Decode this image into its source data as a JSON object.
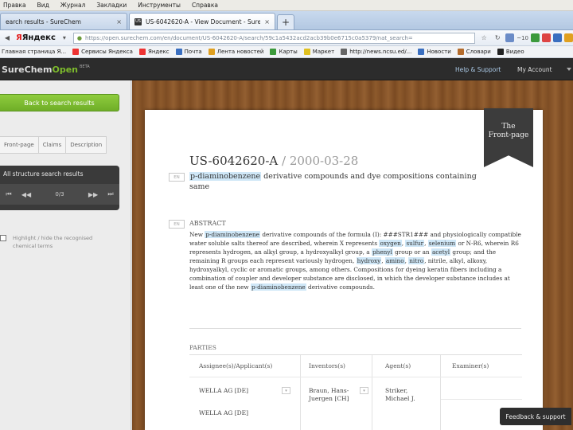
{
  "menu": [
    "Правка",
    "Вид",
    "Журнал",
    "Закладки",
    "Инструменты",
    "Справка"
  ],
  "tabs": [
    {
      "label": "earch results - SureChem",
      "active": false
    },
    {
      "label": "US-6042620-A - View Document - SureCh...",
      "active": true
    }
  ],
  "new_tab": "+",
  "navbar": {
    "brand": "Яндекс",
    "url": "https://open.surechem.com/en/document/US-6042620-A/search/59c1a5432acd2acb39b0e6715c0a5379/nat_search=",
    "right_text": "~10"
  },
  "bookmarks": [
    {
      "label": "Главная страница Я..."
    },
    {
      "label": "Сервисы Яндекса"
    },
    {
      "label": "Яндекс"
    },
    {
      "label": "Почта"
    },
    {
      "label": "Лента новостей"
    },
    {
      "label": "Карты"
    },
    {
      "label": "Маркет"
    },
    {
      "label": "http://news.ncsu.ed/..."
    },
    {
      "label": "Новости"
    },
    {
      "label": "Словари"
    },
    {
      "label": "Видео"
    }
  ],
  "app": {
    "logo_a": "SureChem",
    "logo_b": "Open",
    "beta": "BETA",
    "help": "Help & Support",
    "account": "My Account"
  },
  "sidebar": {
    "back_button": "Back to search results",
    "tabs": [
      "Front-page",
      "Claims",
      "Description"
    ],
    "results_title": "All structure search results",
    "pager_count": "0/3",
    "highlight_text": "Highlight / hide the recognised chemical terms"
  },
  "ribbon": {
    "line1": "The",
    "line2": "Front-page"
  },
  "document": {
    "number": "US-6042620-A",
    "separator": " / ",
    "date": "2000-03-28",
    "lang_tag": "EN",
    "title_highlight": "p-diaminobenzene",
    "title_rest": " derivative compounds and dye compositions containing same",
    "abstract_heading": "ABSTRACT",
    "abstract_parts": [
      {
        "t": "New ",
        "h": false
      },
      {
        "t": "p-diaminobenzene",
        "h": true
      },
      {
        "t": " derivative compounds of the formula (I): ###STR1### and physiologically compatible water soluble salts thereof are described, wherein X represents ",
        "h": false
      },
      {
        "t": "oxygen",
        "h": true
      },
      {
        "t": ", ",
        "h": false
      },
      {
        "t": "sulfur",
        "h": true
      },
      {
        "t": ", ",
        "h": false
      },
      {
        "t": "selenium",
        "h": true
      },
      {
        "t": " or N-R6, wherein R6 represents hydrogen, an alkyl group, a hydroxyalkyl group, a ",
        "h": false
      },
      {
        "t": "phenyl",
        "h": true
      },
      {
        "t": " group or an ",
        "h": false
      },
      {
        "t": "acetyl",
        "h": true
      },
      {
        "t": " group; and the remaining R groups each represent variously hydrogen, ",
        "h": false
      },
      {
        "t": "hydroxy",
        "h": true
      },
      {
        "t": ", ",
        "h": false
      },
      {
        "t": "amino",
        "h": true
      },
      {
        "t": ", ",
        "h": false
      },
      {
        "t": "nitro",
        "h": true
      },
      {
        "t": ", nitrile, alkyl, alkoxy, hydroxyalkyl, cyclic or aromatic groups, among others. Compositions for dyeing keratin fibers including a combination of coupler and developer substance are disclosed, in which the developer substance includes at least one of the new ",
        "h": false
      },
      {
        "t": "p-diaminobenzene",
        "h": true
      },
      {
        "t": " derivative compounds.",
        "h": false
      }
    ]
  },
  "parties": {
    "heading": "PARTIES",
    "columns": [
      "Assignee(s)/Applicant(s)",
      "Inventors(s)",
      "Agent(s)",
      "Examiner(s)"
    ],
    "assignees": [
      "WELLA AG [DE]",
      "WELLA AG [DE]"
    ],
    "inventor": "Braun, Hans-Juergen [CH]",
    "agent": "Striker, Michael J."
  },
  "feedback": "Feedback & support",
  "colors": {
    "accent_green": "#7dbb2c",
    "highlight": "#cfe7f7",
    "wood": "#8d5a2c"
  }
}
